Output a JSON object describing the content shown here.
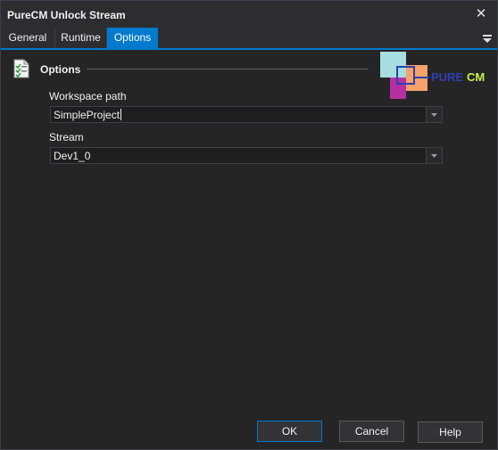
{
  "window": {
    "title": "PureCM Unlock Stream",
    "close_glyph": "✕"
  },
  "tabs": [
    {
      "label": "General",
      "active": false
    },
    {
      "label": "Runtime",
      "active": false
    },
    {
      "label": "Options",
      "active": true
    }
  ],
  "section": {
    "title": "Options",
    "icon": "checklist-icon"
  },
  "logo": {
    "text_part1": "PURE",
    "text_part2": "CM"
  },
  "fields": {
    "workspace_path": {
      "label": "Workspace path",
      "value": "SimpleProject"
    },
    "stream": {
      "label": "Stream",
      "value": "Dev1_0"
    }
  },
  "buttons": {
    "ok": "OK",
    "cancel": "Cancel",
    "help": "Help"
  },
  "colors": {
    "accent": "#007acc",
    "background": "#252526",
    "logo_blue": "#2e3fb0",
    "logo_lime": "#c8f04a"
  }
}
